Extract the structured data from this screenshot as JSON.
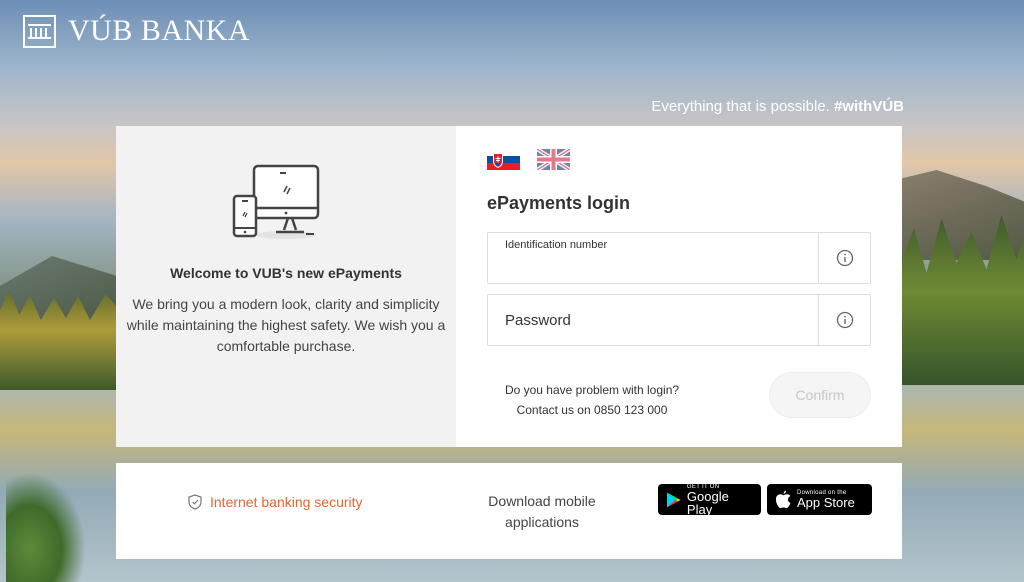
{
  "brand": {
    "name": "VÚB BANKA"
  },
  "slogan": {
    "text": "Everything that is possible.",
    "tag": "#withVÚB"
  },
  "welcome": {
    "title": "Welcome to VUB's  new ePayments",
    "text": "We bring you a modern look, clarity and simplicity while maintaining the highest safety. We wish you a comfortable purchase."
  },
  "languages": [
    {
      "name": "sk-flag-icon",
      "selected": true
    },
    {
      "name": "uk-flag-icon",
      "selected": false
    }
  ],
  "login": {
    "title": "ePayments login",
    "id_label": "Identification number",
    "id_value": "",
    "password_label": "Password",
    "help_line1": "Do you have problem with login?",
    "help_line2": "Contact us on 0850 123 000",
    "confirm_label": "Confirm"
  },
  "footer": {
    "security_link": "Internet banking security",
    "download_text": "Download mobile applications",
    "google_small": "GET IT ON",
    "google_big": "Google Play",
    "apple_small": "Download on the",
    "apple_big": "App Store"
  },
  "colors": {
    "accent": "#e5652e",
    "card_left_bg": "#f2f2f2",
    "confirm_bg": "#f5f5f5",
    "confirm_text": "#c9c9c9"
  }
}
